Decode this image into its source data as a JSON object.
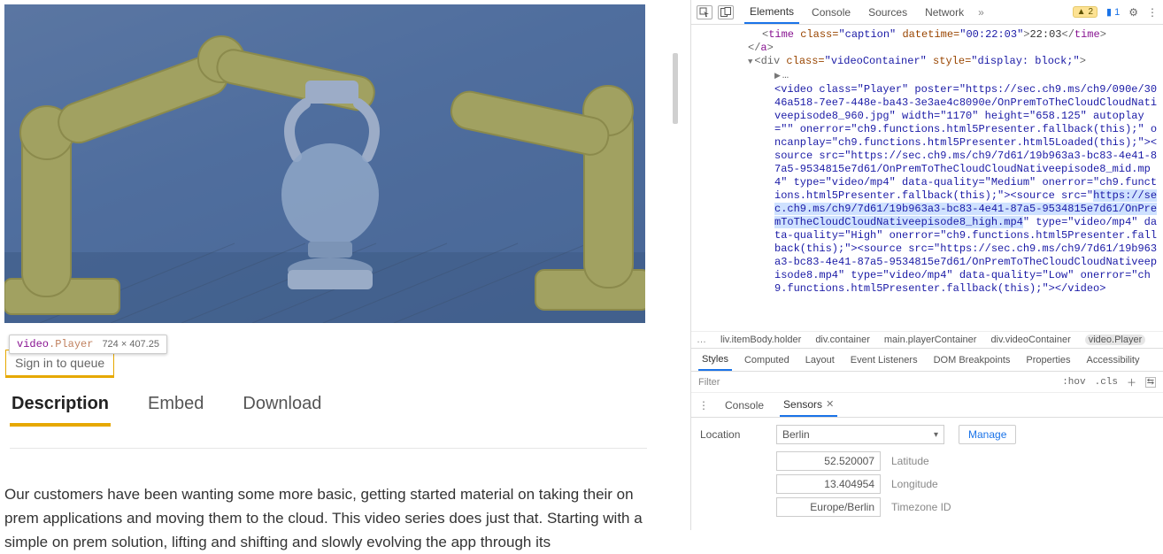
{
  "video": {
    "tooltip_selector_prefix": "video",
    "tooltip_selector_class": ".Player",
    "tooltip_dims": "724 × 407.25",
    "signin_label": "Sign in to queue"
  },
  "tabs": {
    "description": "Description",
    "embed": "Embed",
    "download": "Download"
  },
  "description_text": "Our customers have been wanting some more basic, getting started material on taking their on prem applications and moving them to the cloud. This video series does just that. Starting with a simple on prem solution, lifting and shifting and slowly evolving the app through its",
  "devtools": {
    "panels": [
      "Elements",
      "Console",
      "Sources",
      "Network"
    ],
    "more_glyph": "»",
    "warn_count": "2",
    "msg_count": "1",
    "time_line": {
      "tag_open": "<",
      "tag": "time",
      "class_attr": " class=",
      "class_val": "\"caption\"",
      "dt_attr": " datetime=",
      "dt_val": "\"00:22:03\"",
      "gt": ">",
      "text": "22:03",
      "close": "</",
      "close_tag": "time",
      "close_gt": ">"
    },
    "a_close": "</a>",
    "div_line": {
      "open": "<div ",
      "class": "class=",
      "class_v": "\"videoContainer\"",
      "style": " style=",
      "style_v": "\"display: block;\"",
      "end": ">"
    },
    "video_html_before": "<video class=\"Player\" poster=\"https://sec.ch9.ms/ch9/090e/3046a518-7ee7-448e-ba43-3e3ae4c8090e/OnPremToTheCloudCloudNativeepisode8_960.jpg\" width=\"1170\" height=\"658.125\" autoplay=\"\" onerror=\"ch9.functions.html5Presenter.fallback(this);\" oncanplay=\"ch9.functions.html5Presenter.html5Loaded(this);\"><source src=\"https://sec.ch9.ms/ch9/7d61/19b963a3-bc83-4e41-87a5-9534815e7d61/OnPremToTheCloudCloudNativeepisode8_mid.mp4\" type=\"video/mp4\" data-quality=\"Medium\" onerror=\"ch9.functions.html5Presenter.fallback(this);\"><source src=\"",
    "video_html_highlight": "https://sec.ch9.ms/ch9/7d61/19b963a3-bc83-4e41-87a5-9534815e7d61/OnPremToTheCloudCloudNativeepisode8_high.mp4",
    "video_html_after": "\" type=\"video/mp4\" data-quality=\"High\" onerror=\"ch9.functions.html5Presenter.fallback(this);\"><source src=\"https://sec.ch9.ms/ch9/7d61/19b963a3-bc83-4e41-87a5-9534815e7d61/OnPremToTheCloudCloudNativeepisode8.mp4\" type=\"video/mp4\" data-quality=\"Low\" onerror=\"ch9.functions.html5Presenter.fallback(this);\"></video>",
    "crumbs": [
      "…",
      "liv.itemBody.holder",
      "div.container",
      "main.playerContainer",
      "div.videoContainer",
      "video.Player"
    ],
    "style_tabs": [
      "Styles",
      "Computed",
      "Layout",
      "Event Listeners",
      "DOM Breakpoints",
      "Properties",
      "Accessibility"
    ],
    "filter_placeholder": "Filter",
    "hov": ":hov",
    "cls": ".cls",
    "console_drawer": {
      "console": "Console",
      "sensors": "Sensors"
    },
    "sensors": {
      "location_label": "Location",
      "location_value": "Berlin",
      "manage": "Manage",
      "lat_value": "52.520007",
      "lat_label": "Latitude",
      "lon_value": "13.404954",
      "lon_label": "Longitude",
      "tz_value": "Europe/Berlin",
      "tz_label": "Timezone ID"
    }
  }
}
